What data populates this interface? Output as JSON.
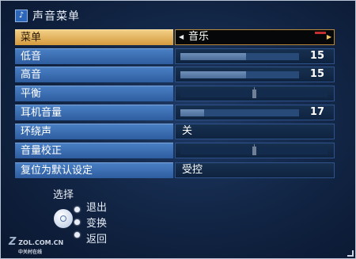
{
  "menu": {
    "title": "声音菜单",
    "icon": "music-note-icon",
    "rows": [
      {
        "label": "菜单",
        "value": "音乐",
        "selected": true
      },
      {
        "label": "低音",
        "level": 0.55,
        "value": "15"
      },
      {
        "label": "高音",
        "level": 0.55,
        "value": "15"
      },
      {
        "label": "平衡",
        "balance": 0.5
      },
      {
        "label": "耳机音量",
        "level": 0.2,
        "value": "17"
      },
      {
        "label": "环绕声",
        "value": "关"
      },
      {
        "label": "音量校正",
        "balance": 0.5
      },
      {
        "label": "复位为默认设定",
        "value": "受控"
      }
    ]
  },
  "help": {
    "select": "选择",
    "exit": "退出",
    "change": "变换",
    "back": "返回"
  },
  "watermark": {
    "site": "ZOL.COM.CN",
    "sub": "中关村在线"
  },
  "colors": {
    "label_bg": "#3a6fb3",
    "selected_bg": "#e6b463",
    "value_bg": "#0e2340"
  }
}
